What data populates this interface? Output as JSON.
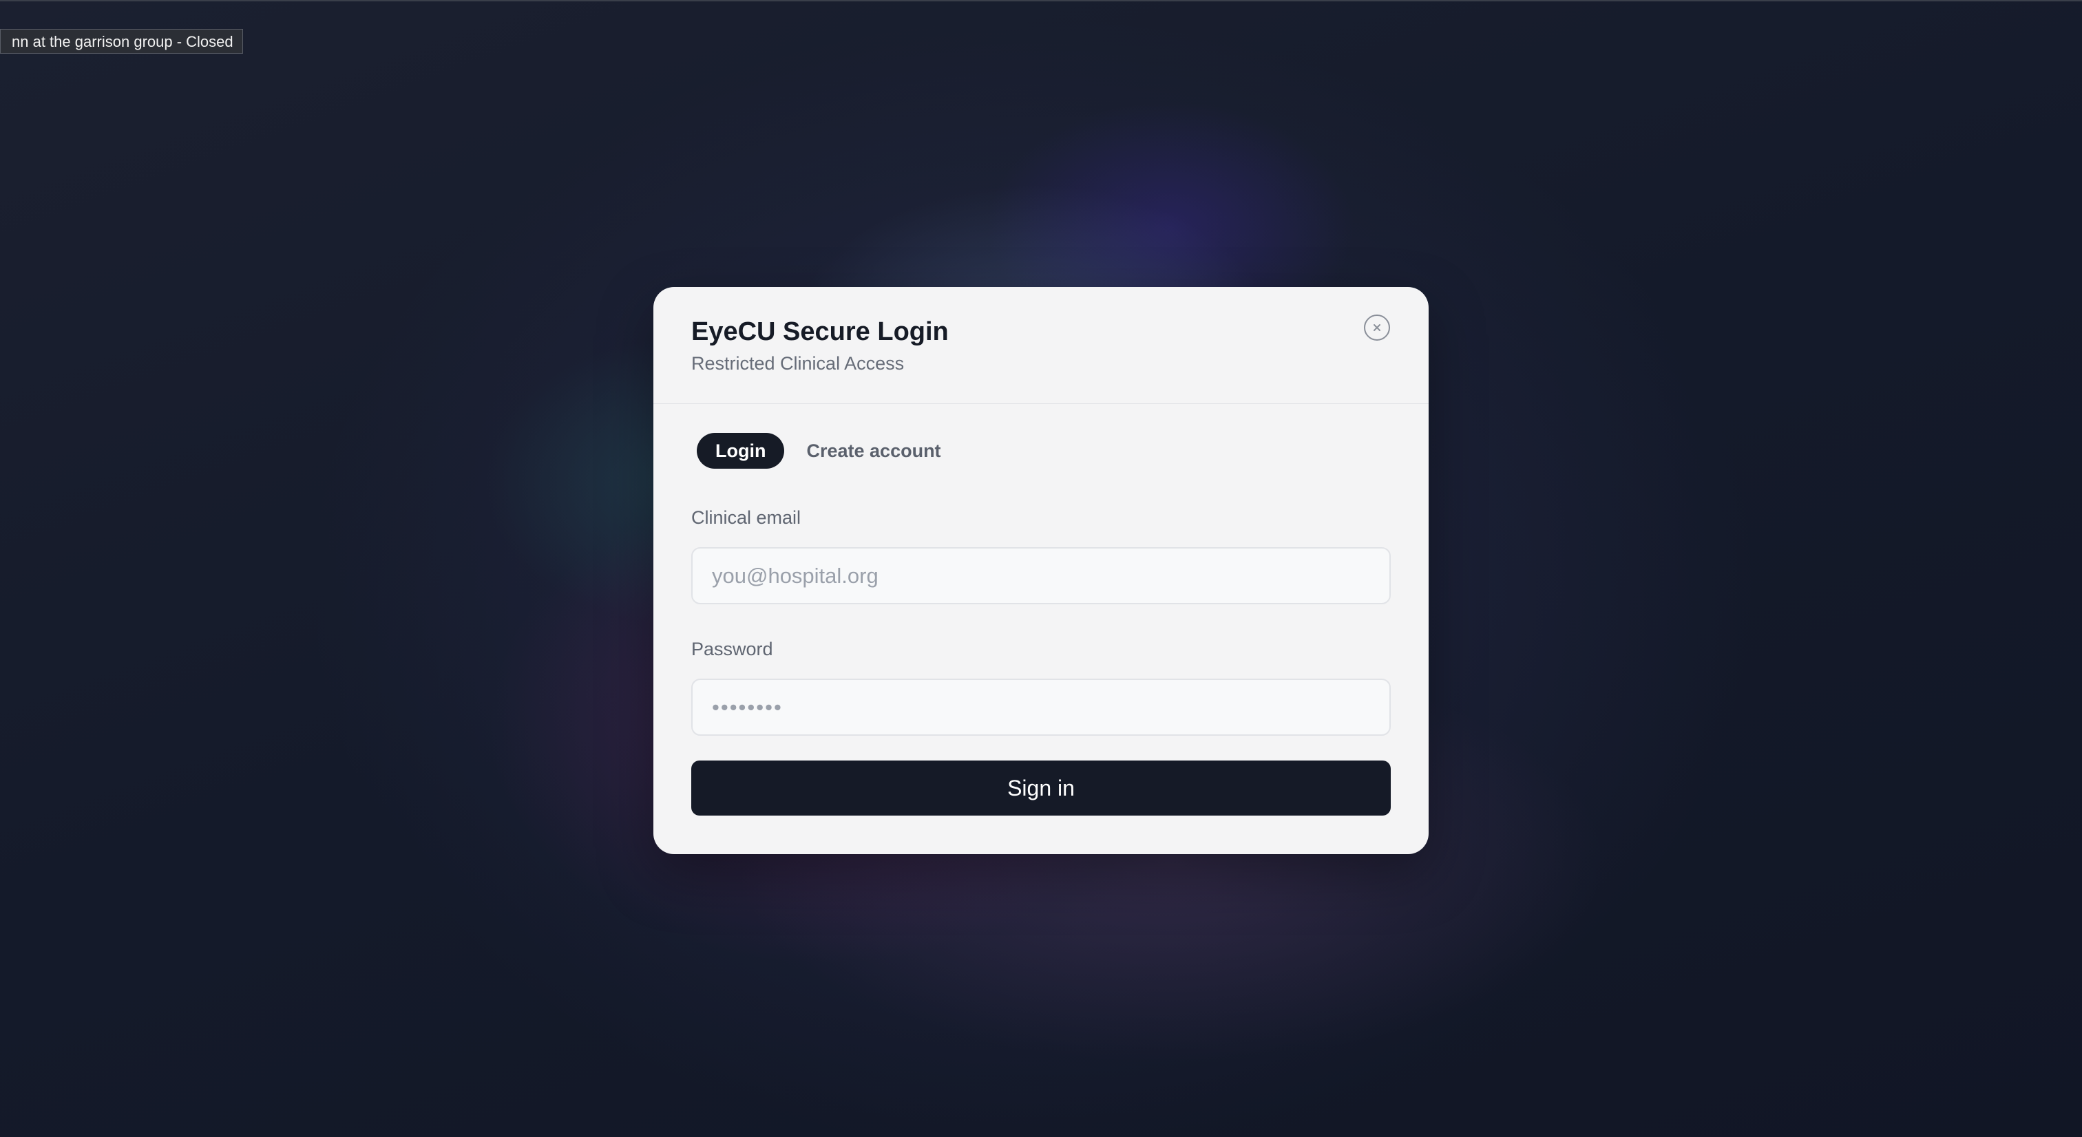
{
  "tooltip": {
    "text": "nn at the garrison group - Closed"
  },
  "modal": {
    "title": "EyeCU Secure Login",
    "subtitle": "Restricted Clinical Access",
    "close_icon": "close-circle-icon",
    "tabs": [
      {
        "label": "Login",
        "active": true
      },
      {
        "label": "Create account",
        "active": false
      }
    ],
    "email": {
      "label": "Clinical email",
      "placeholder": "you@hospital.org",
      "value": ""
    },
    "password": {
      "label": "Password",
      "placeholder": "••••••••",
      "value": ""
    },
    "submit_label": "Sign in"
  },
  "colors": {
    "background": "#121726",
    "modal_bg": "#f4f4f5",
    "primary": "#151a27",
    "muted_text": "#5f6571"
  }
}
